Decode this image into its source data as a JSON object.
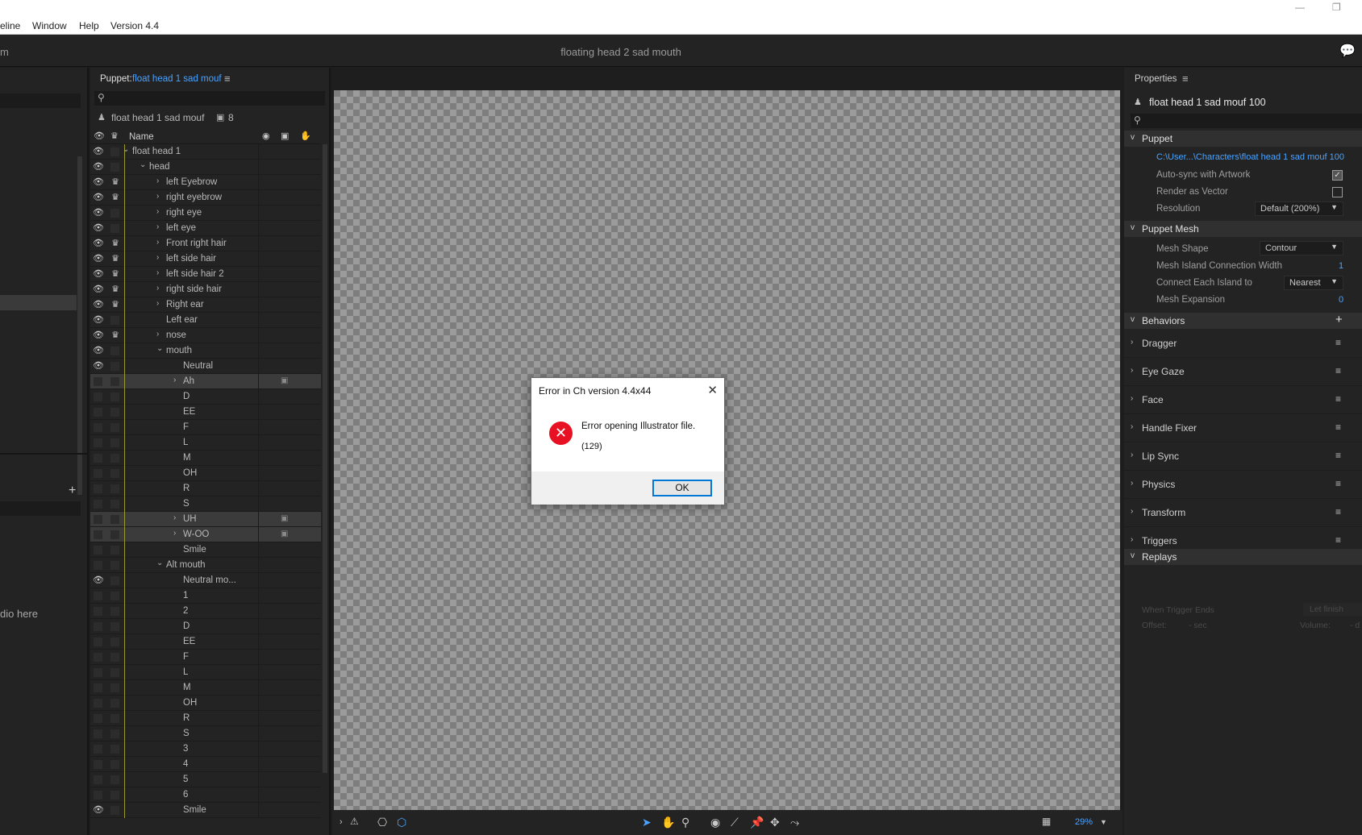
{
  "menubar": {
    "items": [
      "eline",
      "Window",
      "Help",
      "Version 4.4"
    ],
    "minimize": "—",
    "restore": "❐"
  },
  "header": {
    "title": "floating head 2 sad mouth",
    "left_fragment": "m",
    "chat_icon": "💬"
  },
  "leftstrip": {
    "drop_text": "dio here",
    "plus": "+"
  },
  "puppet": {
    "panel_label": "Puppet:",
    "panel_name": "float head 1 sad mouf",
    "menu_icon": "≡",
    "search_icon": "⚲",
    "puppet_name": "float head 1 sad mouf",
    "tag_count": "8",
    "column_name": "Name",
    "rows": [
      {
        "label": "float head 1",
        "indent": 1,
        "chev": "v",
        "eye": true,
        "crown": false
      },
      {
        "label": "head",
        "indent": 2,
        "chev": "v",
        "eye": true,
        "crown": false
      },
      {
        "label": "left Eyebrow",
        "indent": 3,
        "chev": ">",
        "eye": true,
        "crown": true
      },
      {
        "label": "right eyebrow",
        "indent": 3,
        "chev": ">",
        "eye": true,
        "crown": true
      },
      {
        "label": "right eye",
        "indent": 3,
        "chev": ">",
        "eye": true,
        "crown": false
      },
      {
        "label": "left eye",
        "indent": 3,
        "chev": ">",
        "eye": true,
        "crown": false
      },
      {
        "label": "Front right hair",
        "indent": 3,
        "chev": ">",
        "eye": true,
        "crown": true
      },
      {
        "label": "left side hair",
        "indent": 3,
        "chev": ">",
        "eye": true,
        "crown": true
      },
      {
        "label": "left side hair 2",
        "indent": 3,
        "chev": ">",
        "eye": true,
        "crown": true
      },
      {
        "label": "right side hair",
        "indent": 3,
        "chev": ">",
        "eye": true,
        "crown": true
      },
      {
        "label": "Right ear",
        "indent": 3,
        "chev": ">",
        "eye": true,
        "crown": true
      },
      {
        "label": "Left ear",
        "indent": 3,
        "chev": "",
        "eye": true,
        "crown": false
      },
      {
        "label": "nose",
        "indent": 3,
        "chev": ">",
        "eye": true,
        "crown": true
      },
      {
        "label": "mouth",
        "indent": 3,
        "chev": "v",
        "eye": true,
        "crown": false
      },
      {
        "label": "Neutral",
        "indent": 4,
        "chev": "",
        "eye": true,
        "crown": false
      },
      {
        "label": "Ah",
        "indent": 4,
        "chev": ">",
        "eye": false,
        "crown": false,
        "sel": true,
        "tag": true
      },
      {
        "label": "D",
        "indent": 4,
        "chev": "",
        "eye": false,
        "crown": false
      },
      {
        "label": "EE",
        "indent": 4,
        "chev": "",
        "eye": false,
        "crown": false
      },
      {
        "label": "F",
        "indent": 4,
        "chev": "",
        "eye": false,
        "crown": false
      },
      {
        "label": "L",
        "indent": 4,
        "chev": "",
        "eye": false,
        "crown": false
      },
      {
        "label": "M",
        "indent": 4,
        "chev": "",
        "eye": false,
        "crown": false
      },
      {
        "label": "OH",
        "indent": 4,
        "chev": "",
        "eye": false,
        "crown": false
      },
      {
        "label": "R",
        "indent": 4,
        "chev": "",
        "eye": false,
        "crown": false
      },
      {
        "label": "S",
        "indent": 4,
        "chev": "",
        "eye": false,
        "crown": false
      },
      {
        "label": "UH",
        "indent": 4,
        "chev": ">",
        "eye": false,
        "crown": false,
        "sel": true,
        "tag": true
      },
      {
        "label": "W-OO",
        "indent": 4,
        "chev": ">",
        "eye": false,
        "crown": false,
        "sel": true,
        "tag": true
      },
      {
        "label": "Smile",
        "indent": 4,
        "chev": "",
        "eye": false,
        "crown": false
      },
      {
        "label": "Alt mouth",
        "indent": 3,
        "chev": "v",
        "eye": false,
        "crown": false
      },
      {
        "label": "Neutral mo...",
        "indent": 4,
        "chev": "",
        "eye": true,
        "crown": false
      },
      {
        "label": "1",
        "indent": 4,
        "chev": "",
        "eye": false,
        "crown": false
      },
      {
        "label": "2",
        "indent": 4,
        "chev": "",
        "eye": false,
        "crown": false
      },
      {
        "label": "D",
        "indent": 4,
        "chev": "",
        "eye": false,
        "crown": false
      },
      {
        "label": "EE",
        "indent": 4,
        "chev": "",
        "eye": false,
        "crown": false
      },
      {
        "label": "F",
        "indent": 4,
        "chev": "",
        "eye": false,
        "crown": false
      },
      {
        "label": "L",
        "indent": 4,
        "chev": "",
        "eye": false,
        "crown": false
      },
      {
        "label": "M",
        "indent": 4,
        "chev": "",
        "eye": false,
        "crown": false
      },
      {
        "label": "OH",
        "indent": 4,
        "chev": "",
        "eye": false,
        "crown": false
      },
      {
        "label": "R",
        "indent": 4,
        "chev": "",
        "eye": false,
        "crown": false
      },
      {
        "label": "S",
        "indent": 4,
        "chev": "",
        "eye": false,
        "crown": false
      },
      {
        "label": "3",
        "indent": 4,
        "chev": "",
        "eye": false,
        "crown": false
      },
      {
        "label": "4",
        "indent": 4,
        "chev": "",
        "eye": false,
        "crown": false
      },
      {
        "label": "5",
        "indent": 4,
        "chev": "",
        "eye": false,
        "crown": false
      },
      {
        "label": "6",
        "indent": 4,
        "chev": "",
        "eye": false,
        "crown": false
      },
      {
        "label": "Smile",
        "indent": 4,
        "chev": "",
        "eye": true,
        "crown": false
      }
    ]
  },
  "canvas": {
    "zoom": "29%"
  },
  "dialog": {
    "title": "Error in Ch version 4.4x44",
    "close": "✕",
    "message": "Error opening Illustrator file.",
    "code": "(129)",
    "ok": "OK"
  },
  "properties": {
    "title": "Properties",
    "menu_icon": "≡",
    "puppet_name": "float head 1 sad mouf 100",
    "puppet_section": "Puppet",
    "path": "C:\\User...\\Characters\\float head 1 sad mouf 100",
    "auto_sync": "Auto-sync with Artwork",
    "auto_sync_checked": "✓",
    "render_vector": "Render as Vector",
    "resolution": "Resolution",
    "resolution_value": "Default (200%)",
    "mesh_section": "Puppet Mesh",
    "mesh_shape": "Mesh Shape",
    "mesh_shape_value": "Contour",
    "island_width": "Mesh Island Connection Width",
    "island_width_value": "1",
    "connect_island": "Connect Each Island to",
    "connect_island_value": "Nearest",
    "expansion": "Mesh Expansion",
    "expansion_value": "0",
    "behaviors_section": "Behaviors",
    "behaviors_add": "+",
    "behaviors": [
      "Dragger",
      "Eye Gaze",
      "Face",
      "Handle Fixer",
      "Lip Sync",
      "Physics",
      "Transform",
      "Triggers"
    ],
    "replays_section": "Replays",
    "when_trigger_ends": "When Trigger Ends",
    "let_finish": "Let finish",
    "offset": "Offset:",
    "offset_value": "- sec",
    "volume": "Volume:",
    "volume_value": "- d"
  }
}
